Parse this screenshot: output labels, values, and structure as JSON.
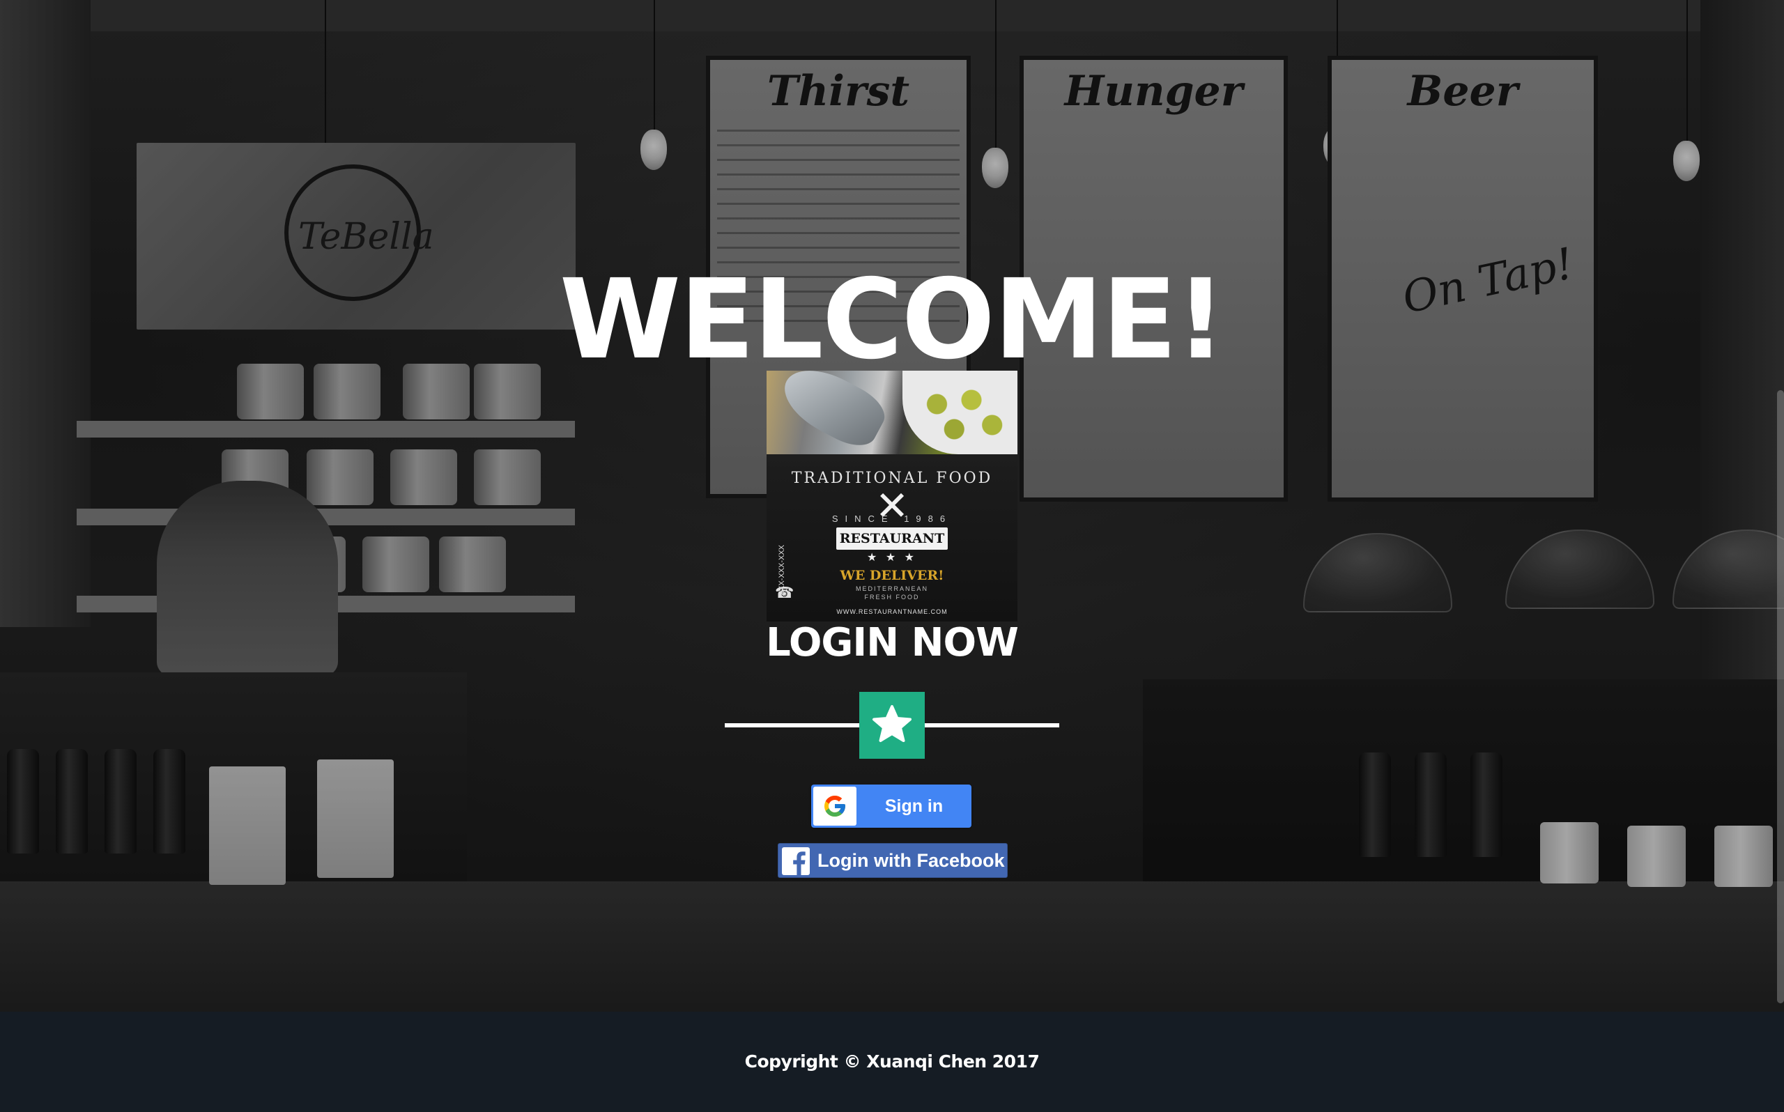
{
  "hero": {
    "heading": "WELCOME!",
    "poster": {
      "arc_text": "TRADITIONAL FOOD",
      "since": "SINCE 1986",
      "banner": "RESTAURANT",
      "stars": "★ ★ ★",
      "tagline": "WE DELIVER!",
      "line1": "MEDITERRANEAN",
      "line2": "FRESH FOOD",
      "url": "WWW.RESTAURANTNAME.COM",
      "phone": "XXX-XXX-XXX"
    },
    "background_signs": {
      "sign": "TeBella",
      "menu_1": "Thirst",
      "menu_2": "Hunger",
      "menu_3": "Beer",
      "menu_3_note": "On Tap!"
    }
  },
  "login": {
    "title": "LOGIN NOW",
    "divider_icon": "star-icon",
    "google_button_label": "Sign in",
    "facebook_button_label": "Login with Facebook"
  },
  "footer": {
    "copyright": "Copyright © Xuanqi Chen 2017"
  },
  "colors": {
    "accent_green": "#1fae84",
    "google_blue": "#4285f4",
    "facebook_blue": "#4267b2",
    "footer_bg": "#151c24"
  }
}
